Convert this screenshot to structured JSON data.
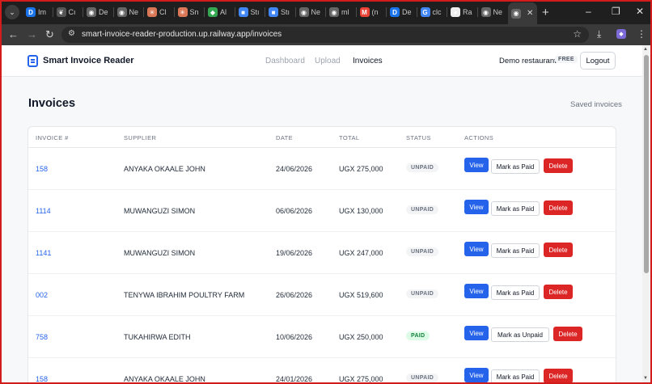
{
  "browser": {
    "tabs": [
      {
        "label": "Im",
        "icon": "D",
        "color": "#1a73e8"
      },
      {
        "label": "Cı",
        "icon": "❦",
        "color": "#555555"
      },
      {
        "label": "De",
        "icon": "◉",
        "color": "#666666"
      },
      {
        "label": "Ne",
        "icon": "◉",
        "color": "#666666"
      },
      {
        "label": "Cl",
        "icon": "✳",
        "color": "#d97757"
      },
      {
        "label": "Sn",
        "icon": "✳",
        "color": "#d97757"
      },
      {
        "label": "Al",
        "icon": "◆",
        "color": "#34a853"
      },
      {
        "label": "Stı",
        "icon": "■",
        "color": "#4285f4"
      },
      {
        "label": "Stı",
        "icon": "■",
        "color": "#4285f4"
      },
      {
        "label": "Ne",
        "icon": "◉",
        "color": "#666666"
      },
      {
        "label": "ml",
        "icon": "◉",
        "color": "#666666"
      },
      {
        "label": "(n",
        "icon": "M",
        "color": "#ea4335"
      },
      {
        "label": "De",
        "icon": "D",
        "color": "#1a73e8"
      },
      {
        "label": "clc",
        "icon": "G",
        "color": "#4285f4"
      },
      {
        "label": "Ra",
        "icon": "●",
        "color": "#eeeeee"
      },
      {
        "label": "Ne",
        "icon": "◉",
        "color": "#666666"
      }
    ],
    "active_tab_icon": "◉",
    "address": "smart-invoice-reader-production.up.railway.app/invoices"
  },
  "app": {
    "brand": "Smart Invoice Reader",
    "nav": {
      "dashboard": "Dashboard",
      "upload": "Upload",
      "invoices": "Invoices"
    },
    "restaurant": "Demo restaurant",
    "plan": "FREE",
    "logout": "Logout"
  },
  "page": {
    "title": "Invoices",
    "subtitle": "Saved invoices"
  },
  "table": {
    "columns": {
      "invoice": "INVOICE #",
      "supplier": "SUPPLIER",
      "date": "DATE",
      "total": "TOTAL",
      "status": "STATUS",
      "actions": "ACTIONS"
    },
    "rows": [
      {
        "invoice": "158",
        "supplier": "ANYAKA OKAALE JOHN",
        "date": "24/06/2026",
        "total": "UGX 275,000",
        "status": "UNPAID",
        "mark": "Mark as Paid"
      },
      {
        "invoice": "1114",
        "supplier": "MUWANGUZI SIMON",
        "date": "06/06/2026",
        "total": "UGX 130,000",
        "status": "UNPAID",
        "mark": "Mark as Paid"
      },
      {
        "invoice": "1141",
        "supplier": "MUWANGUZI SIMON",
        "date": "19/06/2026",
        "total": "UGX 247,000",
        "status": "UNPAID",
        "mark": "Mark as Paid"
      },
      {
        "invoice": "002",
        "supplier": "TENYWA IBRAHIM POULTRY FARM",
        "date": "26/06/2026",
        "total": "UGX 519,600",
        "status": "UNPAID",
        "mark": "Mark as Paid"
      },
      {
        "invoice": "758",
        "supplier": "TUKAHIRWA EDITH",
        "date": "10/06/2026",
        "total": "UGX 250,000",
        "status": "PAID",
        "mark": "Mark as Unpaid"
      },
      {
        "invoice": "158",
        "supplier": "ANYAKA OKAALE JOHN",
        "date": "24/01/2026",
        "total": "UGX 275,000",
        "status": "UNPAID",
        "mark": "Mark as Paid"
      }
    ],
    "view_label": "View",
    "delete_label": "Delete"
  }
}
